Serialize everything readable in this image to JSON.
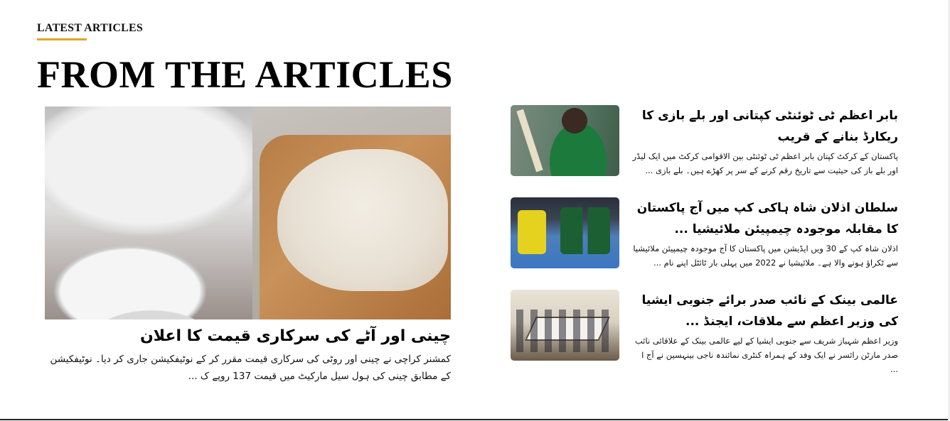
{
  "section": {
    "label": "LATEST ARTICLES",
    "accent_color": "#e0a526",
    "title": "FROM THE ARTICLES"
  },
  "featured": {
    "image": "sugar-and-flour-photo",
    "title": "چینی اور آٹے کی سرکاری قیمت کا اعلان",
    "excerpt": "کمشنر کراچی نے چینی اور روٹی کی سرکاری قیمت مقرر کر کے نوٹیفکیشن جاری کر دیا۔ نوٹیفکیشن کے مطابق چینی کی ہول سیل مارکیٹ میں قیمت 137 روپے ک ..."
  },
  "articles": [
    {
      "image": "babar-azam-cricket-photo",
      "title": "بابر اعظم ٹی ٹوئنٹی کپتانی اور بلے بازی کا ریکارڈ بنانے کے قریب",
      "excerpt": "پاکستان کے کرکٹ کپتان بابر اعظم ٹی ٹوئنٹی بین الاقوامی کرکٹ میں ایک لیڈر اور بلے باز کی حیثیت سے تاریخ رقم کرنے کے سر پر کھڑے ہیں۔ بلے بازی ..."
    },
    {
      "image": "hockey-match-photo",
      "title": "سلطان اذلان شاہ ہاکی کپ میں آج پاکستان کا مقابلہ موجودہ چیمپیئن ملائیشیا ...",
      "excerpt": "اذلان شاہ کپ کے 30 ویں ایڈیشن میں پاکستان کا آج موجودہ چیمپیئن ملائیشیا سے ٹکراؤ ہونے والا ہے۔ ملائیشیا نے 2022 میں پہلی بار ٹائٹل اپنے نام ..."
    },
    {
      "image": "meeting-room-photo",
      "title": "عالمی بینک کے نائب صدر برائے جنوبی ایشیا کی وزیر اعظم سے ملاقات، ایجنڈ ...",
      "excerpt": "وزیر اعظم شہباز شریف سے جنوبی ایشیا کے لیے عالمی بینک کے علاقائی نائب صدر مارٹن رائسر نے ایک وفد کے ہمراہ کنٹری نمائندہ ناجی بینہسین نے آج ا ..."
    }
  ]
}
